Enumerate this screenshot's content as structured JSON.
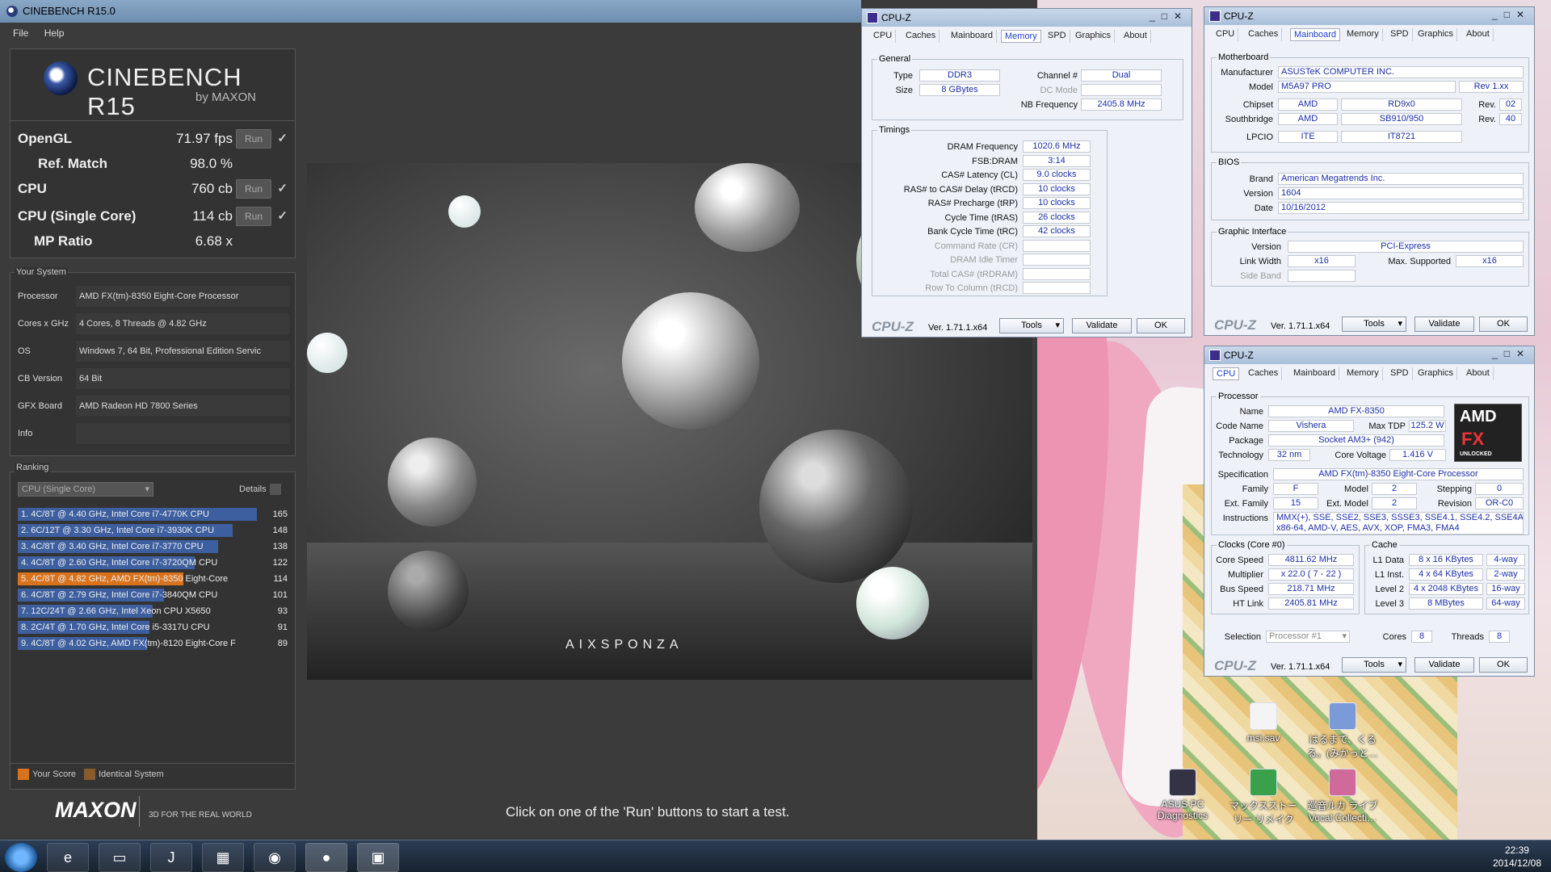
{
  "cinebench": {
    "title": "CINEBENCH R15.0",
    "menu": [
      "File",
      "Help"
    ],
    "logo": {
      "name": "CINEBENCH R15",
      "by": "by MAXON"
    },
    "scores": [
      {
        "label": "OpenGL",
        "value": "71.97 fps",
        "run": "Run",
        "check": "✓"
      },
      {
        "label": "Ref. Match",
        "value": "98.0 %"
      },
      {
        "label": "CPU",
        "value": "760 cb",
        "run": "Run",
        "check": "✓"
      },
      {
        "label": "CPU (Single Core)",
        "value": "114 cb",
        "run": "Run",
        "check": "✓"
      },
      {
        "label": "MP Ratio",
        "value": "6.68 x"
      }
    ],
    "system": {
      "title": "Your System",
      "rows": [
        {
          "label": "Processor",
          "value": "AMD FX(tm)-8350 Eight-Core Processor"
        },
        {
          "label": "Cores x GHz",
          "value": "4 Cores, 8 Threads @ 4.82 GHz"
        },
        {
          "label": "OS",
          "value": "Windows 7, 64 Bit, Professional Edition Servic"
        },
        {
          "label": "CB Version",
          "value": "64 Bit"
        },
        {
          "label": "GFX Board",
          "value": "AMD Radeon HD 7800 Series"
        },
        {
          "label": "Info",
          "value": ""
        }
      ]
    },
    "ranking": {
      "title": "Ranking",
      "selector": "CPU (Single Core)",
      "details": "Details",
      "max": 165,
      "rows": [
        {
          "text": "1. 4C/8T @ 4.40 GHz, Intel Core i7-4770K CPU",
          "score": 165,
          "me": false
        },
        {
          "text": "2. 6C/12T @ 3.30 GHz,  Intel Core i7-3930K CPU",
          "score": 148,
          "me": false
        },
        {
          "text": "3. 4C/8T @ 3.40 GHz,  Intel Core i7-3770 CPU",
          "score": 138,
          "me": false
        },
        {
          "text": "4. 4C/8T @ 2.60 GHz, Intel Core i7-3720QM CPU",
          "score": 122,
          "me": false
        },
        {
          "text": "5. 4C/8T @ 4.82 GHz, AMD FX(tm)-8350 Eight-Core",
          "score": 114,
          "me": true
        },
        {
          "text": "6. 4C/8T @ 2.79 GHz,  Intel Core i7-3840QM CPU",
          "score": 101,
          "me": false
        },
        {
          "text": "7. 12C/24T @ 2.66 GHz, Intel Xeon CPU X5650",
          "score": 93,
          "me": false
        },
        {
          "text": "8. 2C/4T @ 1.70 GHz,  Intel Core i5-3317U CPU",
          "score": 91,
          "me": false
        },
        {
          "text": "9. 4C/8T @ 4.02 GHz, AMD FX(tm)-8120 Eight-Core F",
          "score": 89,
          "me": false
        }
      ],
      "legend_your": "Your Score",
      "legend_identical": "Identical System",
      "your_color": "#d9721c",
      "identical_color": "#8a5a2a"
    },
    "maxon": "MAXON",
    "maxon_tag": "3D FOR THE REAL WORLD",
    "render_brand": "AIXSPONZA",
    "status": "Click on one of the 'Run' buttons to start a test."
  },
  "cpuz_memory": {
    "title": "CPU-Z",
    "tabs": [
      "CPU",
      "Caches",
      "Mainboard",
      "Memory",
      "SPD",
      "Graphics",
      "About"
    ],
    "general_title": "General",
    "type_label": "Type",
    "type": "DDR3",
    "size_label": "Size",
    "size": "8 GBytes",
    "channel_label": "Channel #",
    "channel": "Dual",
    "dcmode_label": "DC Mode",
    "nbfreq_label": "NB Frequency",
    "nbfreq": "2405.8 MHz",
    "timings_title": "Timings",
    "timings": [
      {
        "label": "DRAM Frequency",
        "value": "1020.6 MHz",
        "dim": false
      },
      {
        "label": "FSB:DRAM",
        "value": "3:14",
        "dim": false
      },
      {
        "label": "CAS# Latency (CL)",
        "value": "9.0 clocks",
        "dim": false
      },
      {
        "label": "RAS# to CAS# Delay (tRCD)",
        "value": "10 clocks",
        "dim": false
      },
      {
        "label": "RAS# Precharge (tRP)",
        "value": "10 clocks",
        "dim": false
      },
      {
        "label": "Cycle Time (tRAS)",
        "value": "26 clocks",
        "dim": false
      },
      {
        "label": "Bank Cycle Time (tRC)",
        "value": "42 clocks",
        "dim": false
      },
      {
        "label": "Command Rate (CR)",
        "value": "",
        "dim": true
      },
      {
        "label": "DRAM Idle Timer",
        "value": "",
        "dim": true
      },
      {
        "label": "Total CAS# (tRDRAM)",
        "value": "",
        "dim": true
      },
      {
        "label": "Row To Column (tRCD)",
        "value": "",
        "dim": true
      }
    ],
    "brand": "CPU-Z",
    "version": "Ver. 1.71.1.x64",
    "tools": "Tools",
    "validate": "Validate",
    "ok": "OK"
  },
  "cpuz_mainboard": {
    "title": "CPU-Z",
    "tabs": [
      "CPU",
      "Caches",
      "Mainboard",
      "Memory",
      "SPD",
      "Graphics",
      "About"
    ],
    "motherboard_title": "Motherboard",
    "manufacturer_label": "Manufacturer",
    "manufacturer": "ASUSTeK COMPUTER INC.",
    "model_label": "Model",
    "model": "M5A97 PRO",
    "model_rev": "Rev 1.xx",
    "chipset_label": "Chipset",
    "chipset_vendor": "AMD",
    "chipset": "RD9x0",
    "chipset_rev_label": "Rev.",
    "chipset_rev": "02",
    "southbridge_label": "Southbridge",
    "southbridge_vendor": "AMD",
    "southbridge": "SB910/950",
    "southbridge_rev_label": "Rev.",
    "southbridge_rev": "40",
    "lpcio_label": "LPCIO",
    "lpcio_vendor": "ITE",
    "lpcio": "IT8721",
    "bios_title": "BIOS",
    "brand_label": "Brand",
    "bios_brand": "American Megatrends Inc.",
    "version_label": "Version",
    "bios_version": "1604",
    "date_label": "Date",
    "bios_date": "10/16/2012",
    "gi_title": "Graphic Interface",
    "gi_version_label": "Version",
    "gi_version": "PCI-Express",
    "link_width_label": "Link Width",
    "link_width": "x16",
    "max_supported_label": "Max. Supported",
    "max_supported": "x16",
    "side_band_label": "Side Band",
    "brand": "CPU-Z",
    "version": "Ver. 1.71.1.x64",
    "tools": "Tools",
    "validate": "Validate",
    "ok": "OK"
  },
  "cpuz_cpu": {
    "title": "CPU-Z",
    "tabs": [
      "CPU",
      "Caches",
      "Mainboard",
      "Memory",
      "SPD",
      "Graphics",
      "About"
    ],
    "processor_title": "Processor",
    "name_label": "Name",
    "name": "AMD FX-8350",
    "codename_label": "Code Name",
    "codename": "Vishera",
    "maxtdp_label": "Max TDP",
    "maxtdp": "125.2 W",
    "package_label": "Package",
    "package": "Socket AM3+ (942)",
    "technology_label": "Technology",
    "technology": "32 nm",
    "corevoltage_label": "Core Voltage",
    "corevoltage": "1.416 V",
    "spec_label": "Specification",
    "spec": "AMD FX(tm)-8350 Eight-Core Processor",
    "family_label": "Family",
    "family": "F",
    "model_label": "Model",
    "model": "2",
    "stepping_label": "Stepping",
    "stepping": "0",
    "extfamily_label": "Ext. Family",
    "extfamily": "15",
    "extmodel_label": "Ext. Model",
    "extmodel": "2",
    "revision_label": "Revision",
    "revision": "OR-C0",
    "instructions_label": "Instructions",
    "instructions_1": "MMX(+), SSE, SSE2, SSE3, SSSE3, SSE4.1, SSE4.2, SSE4A,",
    "instructions_2": "x86-64, AMD-V, AES, AVX, XOP, FMA3, FMA4",
    "amd_logo_1": "AMD",
    "amd_logo_2": "FX",
    "amd_logo_3": "UNLOCKED",
    "clocks_title": "Clocks (Core #0)",
    "corespeed_label": "Core Speed",
    "corespeed": "4811.62 MHz",
    "multiplier_label": "Multiplier",
    "multiplier": "x 22.0 ( 7 - 22 )",
    "busspeed_label": "Bus Speed",
    "busspeed": "218.71 MHz",
    "htlink_label": "HT Link",
    "htlink": "2405.81 MHz",
    "cache_title": "Cache",
    "l1data_label": "L1 Data",
    "l1data": "8 x 16 KBytes",
    "l1data_way": "4-way",
    "l1inst_label": "L1 Inst.",
    "l1inst": "4 x 64 KBytes",
    "l1inst_way": "2-way",
    "l2_label": "Level 2",
    "l2": "4 x 2048 KBytes",
    "l2_way": "16-way",
    "l3_label": "Level 3",
    "l3": "8 MBytes",
    "l3_way": "64-way",
    "selection_label": "Selection",
    "selection": "Processor #1",
    "cores_label": "Cores",
    "cores": "8",
    "threads_label": "Threads",
    "threads": "8",
    "brand": "CPU-Z",
    "version": "Ver. 1.71.1.x64",
    "tools": "Tools",
    "validate": "Validate",
    "ok": "OK"
  },
  "desktop": {
    "icons": [
      {
        "label": "msi.sav"
      },
      {
        "label": "はるまで、くるる。(みかっと…"
      },
      {
        "label": "ASUS PC Diagnostics"
      },
      {
        "label": "マックスストーリー リメイク"
      },
      {
        "label": "巡音ルカ ライブ Vocal Collecti…"
      }
    ]
  },
  "taskbar": {
    "time": "22:39",
    "date": "2014/12/08",
    "apps": [
      "ie-icon",
      "explorer-icon",
      "notepad-icon",
      "cpuid-icon",
      "chrome-icon",
      "cinebench-icon",
      "cpuz-icon"
    ]
  }
}
